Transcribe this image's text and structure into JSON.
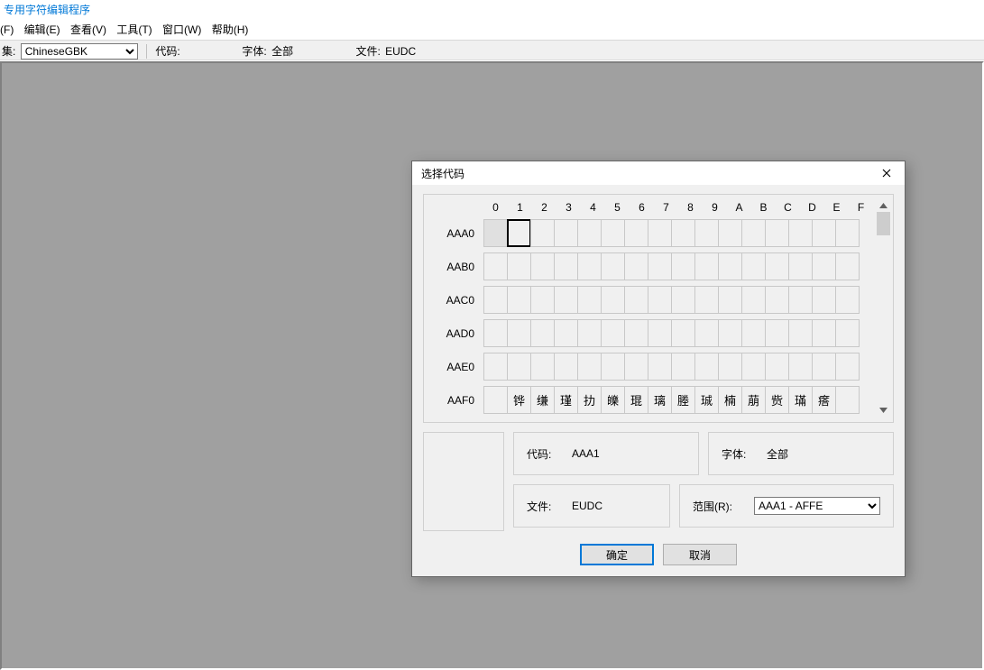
{
  "window": {
    "title": "专用字符编辑程序"
  },
  "menu": {
    "items": [
      "(F)",
      "编辑(E)",
      "查看(V)",
      "工具(T)",
      "窗口(W)",
      "帮助(H)"
    ]
  },
  "toolbar": {
    "charset_label": "集:",
    "charset_value": "ChineseGBK",
    "code_label": "代码:",
    "code_value": "",
    "font_label": "字体:",
    "font_value": "全部",
    "file_label": "文件:",
    "file_value": "EUDC"
  },
  "dialog": {
    "title": "选择代码",
    "columns": [
      "0",
      "1",
      "2",
      "3",
      "4",
      "5",
      "6",
      "7",
      "8",
      "9",
      "A",
      "B",
      "C",
      "D",
      "E",
      "F"
    ],
    "rows": [
      {
        "label": "AAA0",
        "cells": [
          "",
          "",
          "",
          "",
          "",
          "",
          "",
          "",
          "",
          "",
          "",
          "",
          "",
          "",
          "",
          ""
        ],
        "disabled0": true,
        "selected": 1
      },
      {
        "label": "AAB0",
        "cells": [
          "",
          "",
          "",
          "",
          "",
          "",
          "",
          "",
          "",
          "",
          "",
          "",
          "",
          "",
          "",
          ""
        ]
      },
      {
        "label": "AAC0",
        "cells": [
          "",
          "",
          "",
          "",
          "",
          "",
          "",
          "",
          "",
          "",
          "",
          "",
          "",
          "",
          "",
          ""
        ]
      },
      {
        "label": "AAD0",
        "cells": [
          "",
          "",
          "",
          "",
          "",
          "",
          "",
          "",
          "",
          "",
          "",
          "",
          "",
          "",
          "",
          ""
        ]
      },
      {
        "label": "AAE0",
        "cells": [
          "",
          "",
          "",
          "",
          "",
          "",
          "",
          "",
          "",
          "",
          "",
          "",
          "",
          "",
          "",
          ""
        ]
      },
      {
        "label": "AAF0",
        "cells": [
          "",
          "铧",
          "缣",
          "瑾",
          "扐",
          "皪",
          "琨",
          "璃",
          "塍",
          "珹",
          "楠",
          "萠",
          "赀",
          "璊",
          "瘩",
          ""
        ]
      }
    ],
    "info": {
      "code_label": "代码:",
      "code_value": "AAA1",
      "font_label": "字体:",
      "font_value": "全部",
      "file_label": "文件:",
      "file_value": "EUDC",
      "range_label": "范围(R):",
      "range_value": "AAA1 - AFFE"
    },
    "buttons": {
      "ok": "确定",
      "cancel": "取消"
    }
  }
}
